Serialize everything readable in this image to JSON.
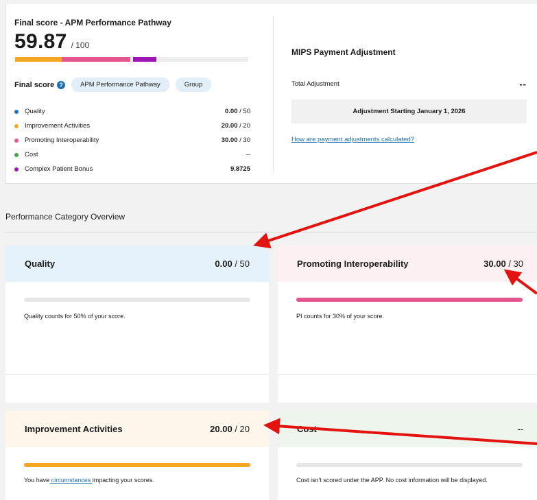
{
  "final_score": {
    "title": "Final score - APM Performance Pathway",
    "value": "59.87",
    "max_label": "/ 100",
    "bar_fractions": {
      "improvement_activities": 0.2,
      "promoting_interoperability": 0.3,
      "complex_patient_bonus": 0.0987
    },
    "label": "Final score",
    "help_icon": "?",
    "pills": [
      "APM Performance Pathway",
      "Group"
    ],
    "categories": [
      {
        "name": "Quality",
        "score": "0.00",
        "max": " / 50",
        "color": "#1a73c9"
      },
      {
        "name": "Improvement Activities",
        "score": "20.00",
        "max": " / 20",
        "color": "#f5a623"
      },
      {
        "name": "Promoting Interoperability",
        "score": "30.00",
        "max": " / 30",
        "color": "#e4568d"
      },
      {
        "name": "Cost",
        "score": "--",
        "max": "",
        "color": "#3fa34d"
      },
      {
        "name": "Complex Patient Bonus",
        "score": "9.8725",
        "max": "",
        "color": "#9b16b5"
      }
    ]
  },
  "mips": {
    "title": "MIPS Payment Adjustment",
    "total_label": "Total Adjustment",
    "total_value": "--",
    "adjustment_start": "Adjustment Starting January 1, 2026",
    "link": "How are payment adjustments calculated?"
  },
  "overview": {
    "title": "Performance Category Overview",
    "cards": {
      "quality": {
        "name": "Quality",
        "score": "0.00",
        "max": " / 50",
        "progress": 0.0,
        "description": "Quality counts for 50% of your score.",
        "head_color": "#e5f2fb"
      },
      "pi": {
        "name": "Promoting Interoperability",
        "score": "30.00",
        "max": " / 30",
        "progress": 1.0,
        "description": "PI counts for 30% of your score.",
        "head_color": "#fdf0f3",
        "bar_color": "#e4568d"
      },
      "ia": {
        "name": "Improvement Activities",
        "score": "20.00",
        "max": " / 20",
        "progress": 1.0,
        "description_prefix": "You have",
        "description_link": " circumstances ",
        "description_suffix": "impacting your scores.",
        "head_color": "#fef6ea",
        "bar_color": "#f5a623"
      },
      "cost": {
        "name": "Cost",
        "score": "--",
        "progress": 0.0,
        "description": "Cost isn't scored under the APP. No cost information will be displayed.",
        "head_color": "#edf5ec"
      }
    }
  },
  "colors": {
    "annotation_arrow": "#e3130f",
    "link": "#1a6fb5"
  }
}
